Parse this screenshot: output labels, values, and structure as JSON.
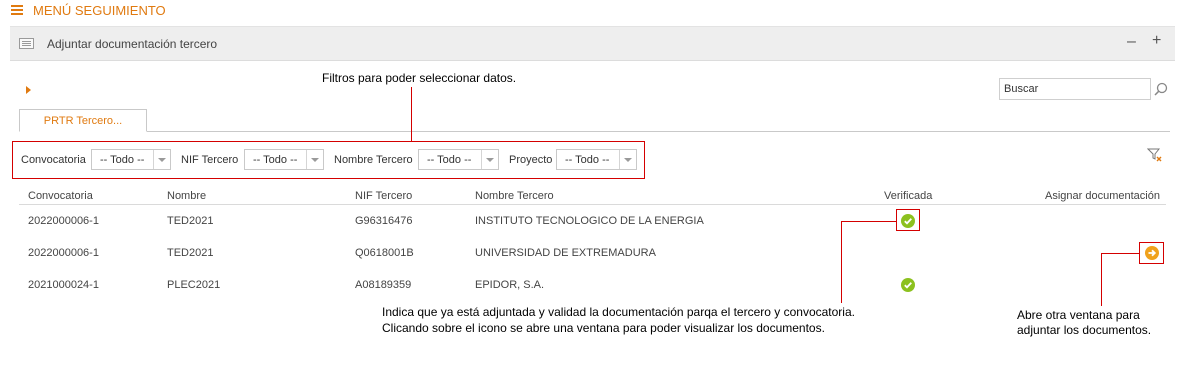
{
  "menu": {
    "title": "MENÚ SEGUIMIENTO"
  },
  "panel": {
    "title": "Adjuntar documentación tercero",
    "collapse": "–",
    "expand": "+"
  },
  "search": {
    "placeholder": "Buscar"
  },
  "tabs": [
    {
      "label": "PRTR Tercero..."
    }
  ],
  "filters": [
    {
      "label": "Convocatoria",
      "value": "-- Todo --"
    },
    {
      "label": "NIF Tercero",
      "value": "-- Todo --"
    },
    {
      "label": "Nombre Tercero",
      "value": "-- Todo --"
    },
    {
      "label": "Proyecto",
      "value": "-- Todo --"
    }
  ],
  "table": {
    "columns": [
      "Convocatoria",
      "Nombre",
      "NIF Tercero",
      "Nombre Tercero",
      "Verificada",
      "Asignar documentación"
    ],
    "rows": [
      {
        "convocatoria": "2022000006-1",
        "nombre": "TED2021",
        "nif": "G96316476",
        "nombre_tercero": "INSTITUTO TECNOLOGICO DE LA ENERGIA",
        "verificada": true,
        "asignar": false
      },
      {
        "convocatoria": "2022000006-1",
        "nombre": "TED2021",
        "nif": "Q0618001B",
        "nombre_tercero": "UNIVERSIDAD DE EXTREMADURA",
        "verificada": false,
        "asignar": true
      },
      {
        "convocatoria": "2021000024-1",
        "nombre": "PLEC2021",
        "nif": "A08189359",
        "nombre_tercero": "EPIDOR, S.A.",
        "verificada": true,
        "asignar": false
      }
    ]
  },
  "annotations": {
    "filters": "Filtros para poder seleccionar datos.",
    "verificada_line1": "Indica que ya está adjuntada y validad la documentación parqa el tercero y convocatoria.",
    "verificada_line2": "Clicando sobre el icono se abre una ventana para poder visualizar los documentos.",
    "asignar_line1": "Abre otra ventana para",
    "asignar_line2": "adjuntar los documentos."
  },
  "colors": {
    "accent": "#e07a10",
    "check": "#8cc11f",
    "annotation": "#d40000"
  }
}
